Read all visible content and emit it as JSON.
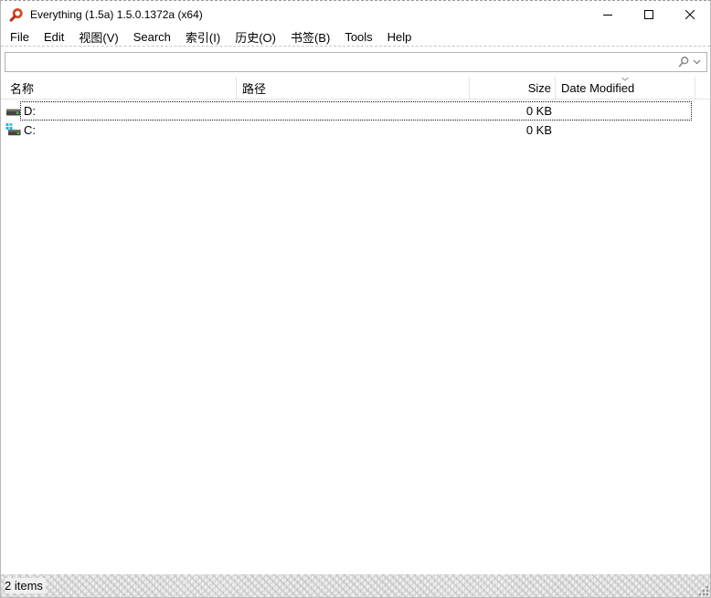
{
  "window": {
    "title": "Everything (1.5a) 1.5.0.1372a (x64)",
    "controls": [
      "minimize",
      "maximize",
      "close"
    ]
  },
  "menu": {
    "items": [
      "File",
      "Edit",
      "视图(V)",
      "Search",
      "索引(I)",
      "历史(O)",
      "书签(B)",
      "Tools",
      "Help"
    ]
  },
  "search": {
    "value": "",
    "placeholder": ""
  },
  "table": {
    "columns": [
      {
        "label": "名称"
      },
      {
        "label": "路径"
      },
      {
        "label": "Size"
      },
      {
        "label": "Date Modified",
        "sort": "desc"
      }
    ],
    "rows": [
      {
        "name": "D:",
        "path": "",
        "size": "0 KB",
        "date_modified": "",
        "icon": "hard-drive-icon",
        "focused": true
      },
      {
        "name": "C:",
        "path": "",
        "size": "0 KB",
        "date_modified": "",
        "icon": "system-drive-icon",
        "focused": false
      }
    ]
  },
  "status_bar": {
    "items_count": "2 items"
  },
  "colors": {
    "app_icon_orange": "#d8441f",
    "app_icon_dark": "#b23315",
    "drive_body": "#45453e",
    "drive_top": "#6e6e64",
    "drive_led_green": "#54c254",
    "windows_logo_blue": "#2bb0e4",
    "focus_outline": "#161616",
    "header_separator": "#e4e4e4",
    "statusbar_bg": "#f0f0f0",
    "search_border": "#b2b2b2",
    "icon_gray": "#8a8a8a"
  }
}
